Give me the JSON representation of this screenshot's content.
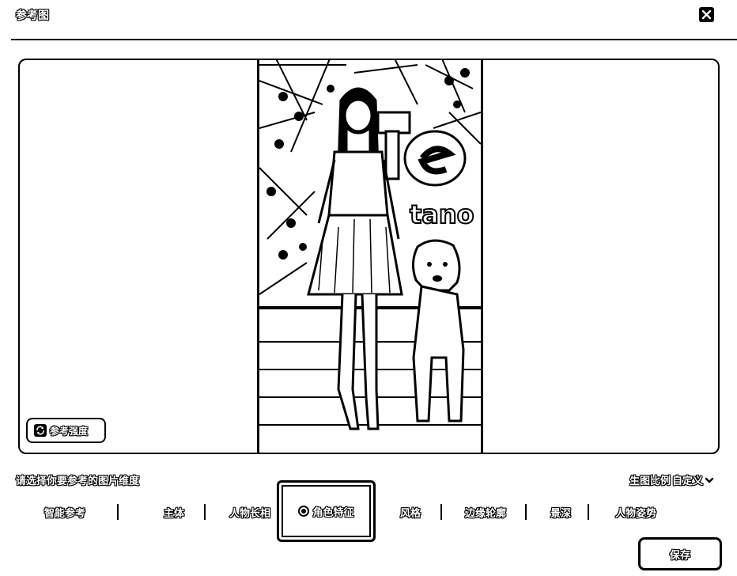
{
  "dialog": {
    "title": "参考图",
    "close_icon": "close-icon"
  },
  "preview": {
    "strength_button": {
      "icon": "refresh-icon",
      "label": "参考强度"
    }
  },
  "dimension": {
    "prompt": "请选择你要参考的图片维度",
    "ratio_label": "生图比例",
    "ratio_value": "自定义",
    "ratio_icon": "chevron-down-icon"
  },
  "chips": [
    {
      "label": "智能参考",
      "selected": false
    },
    {
      "label": "主体",
      "selected": false
    },
    {
      "label": "人物长相",
      "selected": false
    },
    {
      "label": "角色特征",
      "selected": true
    },
    {
      "label": "风格",
      "selected": false
    },
    {
      "label": "边缘轮廓",
      "selected": false
    },
    {
      "label": "景深",
      "selected": false
    },
    {
      "label": "人物姿势",
      "selected": false
    }
  ],
  "footer": {
    "save_label": "保存"
  }
}
